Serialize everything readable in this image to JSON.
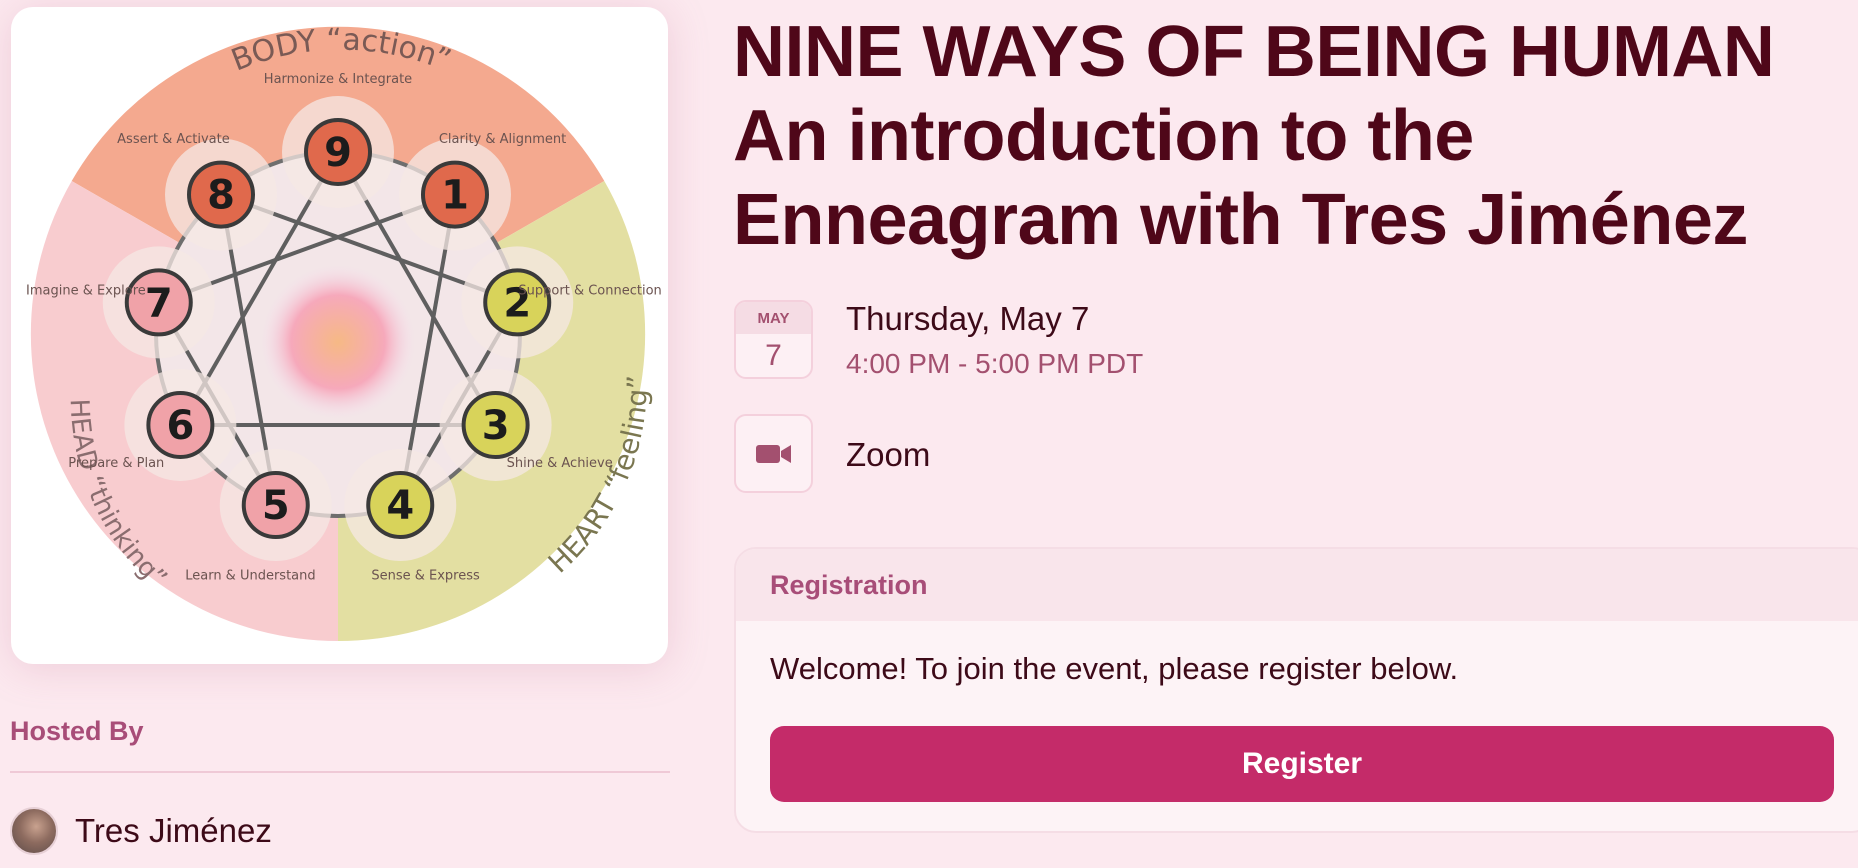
{
  "event": {
    "title": "NINE WAYS OF BEING HUMAN An introduction to the Enneagram with Tres Jiménez",
    "date_month": "MAY",
    "date_day": "7",
    "date_text": "Thursday, May 7",
    "time_text": "4:00 PM - 5:00 PM PDT",
    "location": "Zoom",
    "location_icon": "video-camera-icon"
  },
  "cover_image": {
    "center_labels": {
      "body": "BODY “action”",
      "heart": "HEART “feeling”",
      "head": "HEAD “thinking”"
    },
    "points": [
      {
        "number": "9",
        "label": "Harmonize & Integrate"
      },
      {
        "number": "1",
        "label": "Clarity & Alignment"
      },
      {
        "number": "2",
        "label": "Support & Connection"
      },
      {
        "number": "3",
        "label": "Shine & Achieve"
      },
      {
        "number": "4",
        "label": "Sense & Express"
      },
      {
        "number": "5",
        "label": "Learn & Understand"
      },
      {
        "number": "6",
        "label": "Prepare & Plan"
      },
      {
        "number": "7",
        "label": "Imagine & Explore"
      },
      {
        "number": "8",
        "label": "Assert & Activate"
      }
    ],
    "colors": {
      "body": "#f4a98f",
      "heart": "#e3dfa2",
      "head": "#f8cccf"
    }
  },
  "host": {
    "section_label": "Hosted By",
    "name": "Tres Jiménez"
  },
  "registration": {
    "header": "Registration",
    "welcome": "Welcome! To join the event, please register below.",
    "button_label": "Register"
  },
  "colors": {
    "background": "#fce9ef",
    "accent": "#c42b69",
    "title": "#4f0719",
    "muted": "#a3506f"
  }
}
